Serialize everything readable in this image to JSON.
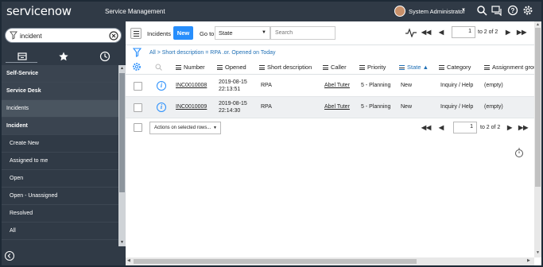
{
  "header": {
    "logo": "servicenow",
    "product": "Service Management",
    "user_name": "System Administrator"
  },
  "sidebar": {
    "filter_value": "incident",
    "nav": [
      {
        "label": "Self-Service",
        "kind": "section"
      },
      {
        "label": "Service Desk",
        "kind": "section"
      },
      {
        "label": "Incidents",
        "kind": "active"
      },
      {
        "label": "Incident",
        "kind": "app"
      },
      {
        "label": "Create New",
        "kind": "module"
      },
      {
        "label": "Assigned to me",
        "kind": "module"
      },
      {
        "label": "Open",
        "kind": "module"
      },
      {
        "label": "Open - Unassigned",
        "kind": "module"
      },
      {
        "label": "Resolved",
        "kind": "module"
      },
      {
        "label": "All",
        "kind": "module"
      }
    ]
  },
  "toolbar": {
    "list_title": "Incidents",
    "new_label": "New",
    "goto_label": "Go to",
    "goto_field": "State",
    "search_placeholder": "Search",
    "page_value": "1",
    "page_of": "to 2 of 2"
  },
  "breadcrumb": "All > Short description = RPA .or. Opened on Today",
  "columns": [
    "Number",
    "Opened",
    "Short description",
    "Caller",
    "Priority",
    "State",
    "Category",
    "Assignment group"
  ],
  "rows": [
    {
      "number": "INC0010008",
      "opened_date": "2019-08-15",
      "opened_time": "22:13:51",
      "short_description": "RPA",
      "caller": "Abel Tuter",
      "priority": "5 - Planning",
      "state": "New",
      "category": "Inquiry / Help",
      "assignment_group": "(empty)"
    },
    {
      "number": "INC0010009",
      "opened_date": "2019-08-15",
      "opened_time": "22:14:30",
      "short_description": "RPA",
      "caller": "Abel Tuter",
      "priority": "5 - Planning",
      "state": "New",
      "category": "Inquiry / Help",
      "assignment_group": "(empty)"
    }
  ],
  "footer": {
    "actions_label": "Actions on selected rows...",
    "page_value": "1",
    "page_of": "to 2 of 2"
  },
  "colors": {
    "topbar": "#303a46",
    "accent": "#278efc",
    "link": "#1f6fb5"
  }
}
